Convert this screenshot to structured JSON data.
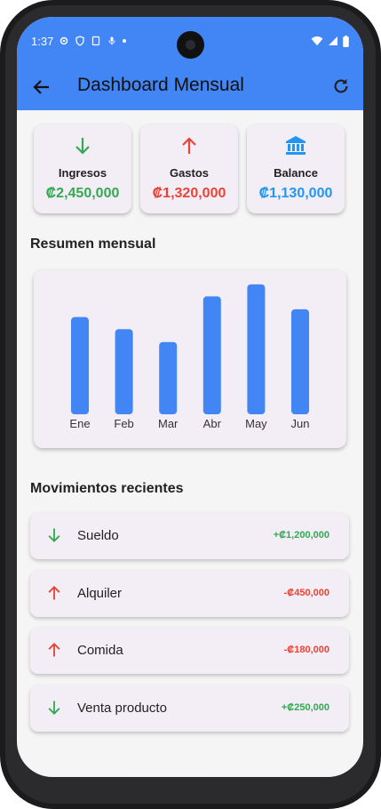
{
  "status_bar": {
    "time": "1:37"
  },
  "app_bar": {
    "title": "Dashboard Mensual"
  },
  "summary": [
    {
      "label": "Ingresos",
      "amount": "₡2,450,000",
      "color": "#34a853",
      "icon": "arrow-down-icon"
    },
    {
      "label": "Gastos",
      "amount": "₡1,320,000",
      "color": "#ea4335",
      "icon": "arrow-up-icon"
    },
    {
      "label": "Balance",
      "amount": "₡1,130,000",
      "color": "#2196f3",
      "icon": "bank-icon"
    }
  ],
  "chart_section_title": "Resumen mensual",
  "chart_data": {
    "type": "bar",
    "categories": [
      "Ene",
      "Feb",
      "Mar",
      "Abr",
      "May",
      "Jun"
    ],
    "values": [
      113,
      99,
      84,
      137,
      151,
      122
    ],
    "ylim": [
      0,
      155
    ],
    "color": "#4285f4",
    "title": "",
    "xlabel": "",
    "ylabel": ""
  },
  "movements_title": "Movimientos recientes",
  "movements": [
    {
      "label": "Sueldo",
      "amount": "+₡1,200,000",
      "type": "income",
      "icon": "arrow-down-icon"
    },
    {
      "label": "Alquiler",
      "amount": "-₡450,000",
      "type": "expense",
      "icon": "arrow-up-icon"
    },
    {
      "label": "Comida",
      "amount": "-₡180,000",
      "type": "expense",
      "icon": "arrow-up-icon"
    },
    {
      "label": "Venta producto",
      "amount": "+₡250,000",
      "type": "income",
      "icon": "arrow-down-icon"
    }
  ],
  "colors": {
    "income": "#34a853",
    "expense": "#ea4335",
    "accent": "#4285f4"
  }
}
